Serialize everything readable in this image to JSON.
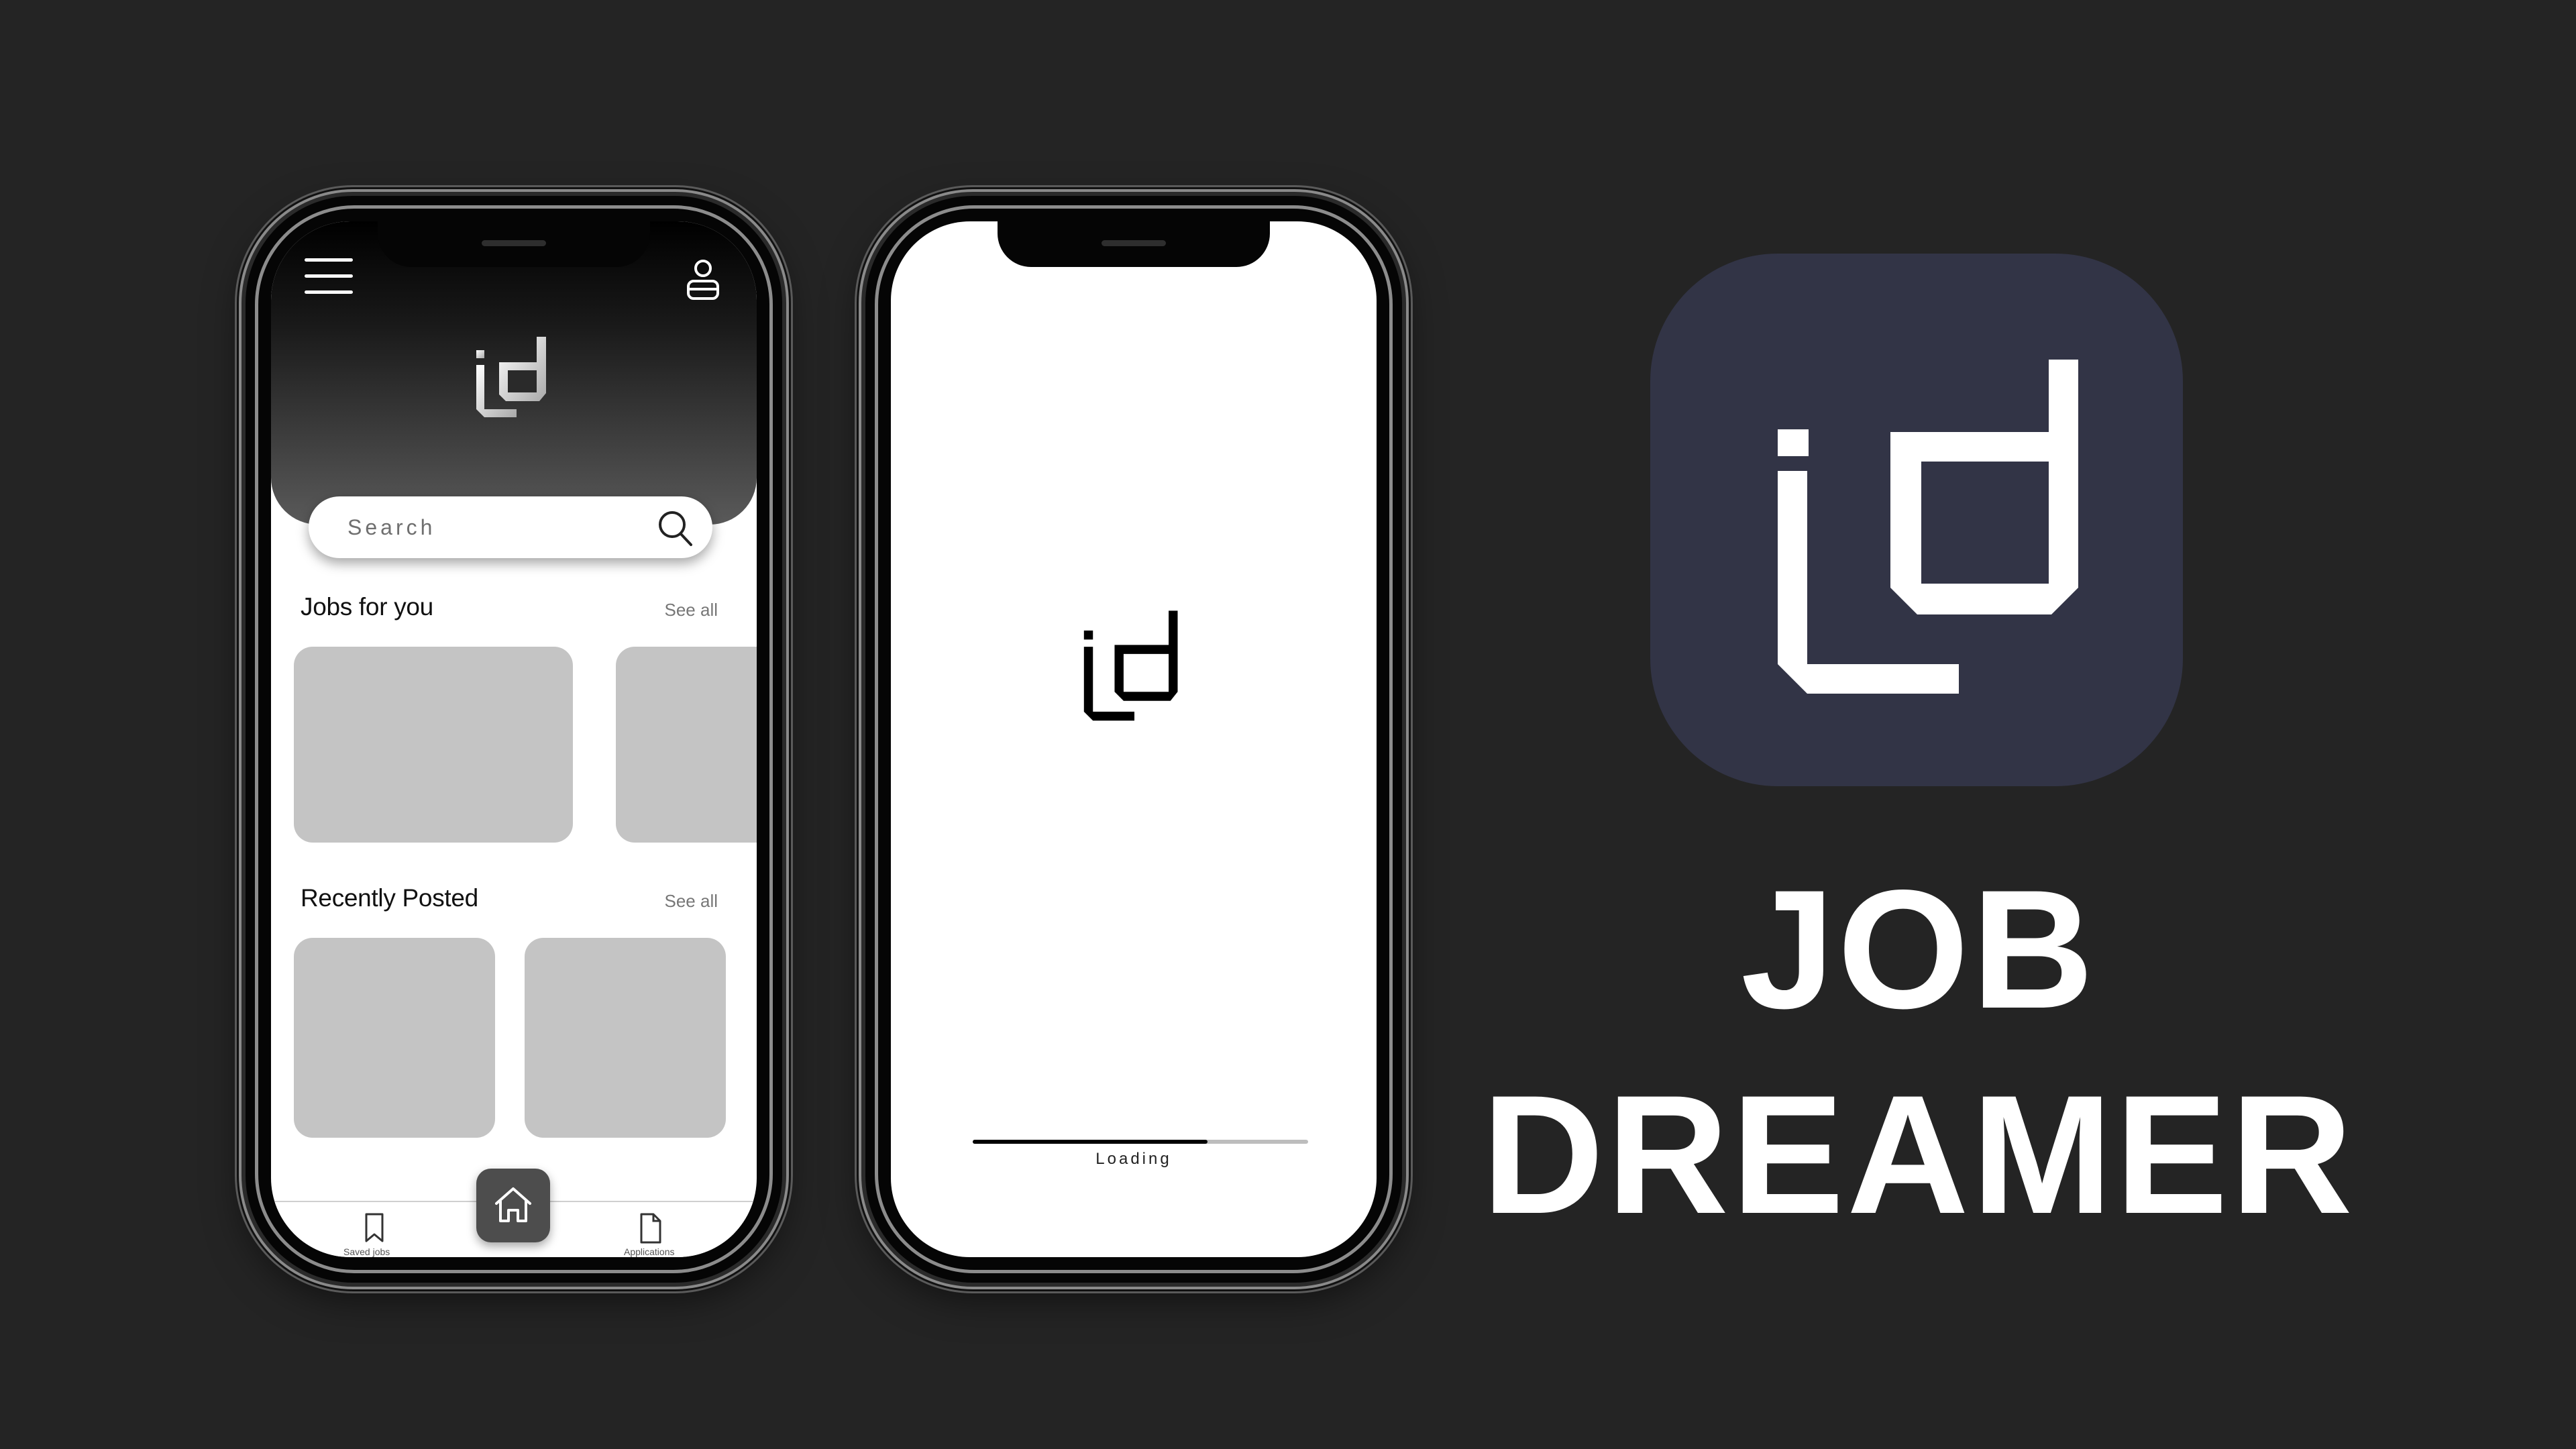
{
  "home_screen": {
    "search": {
      "placeholder": "Search"
    },
    "sections": {
      "jobs_for_you": {
        "title": "Jobs for you",
        "see_all": "See all"
      },
      "recently_posted": {
        "title": "Recently Posted",
        "see_all": "See all"
      }
    },
    "bottom_nav": [
      {
        "icon": "bookmark-icon",
        "label": "Saved jobs"
      },
      {
        "icon": "home-icon",
        "label": ""
      },
      {
        "icon": "document-icon",
        "label": "Applications"
      }
    ]
  },
  "loading_screen": {
    "loading_text": "Loading",
    "progress": 0.7
  },
  "brand": {
    "title_line1": "JOB",
    "title_line2": "DREAMER",
    "icon_bg": "#323446",
    "accent": "#ffffff"
  }
}
